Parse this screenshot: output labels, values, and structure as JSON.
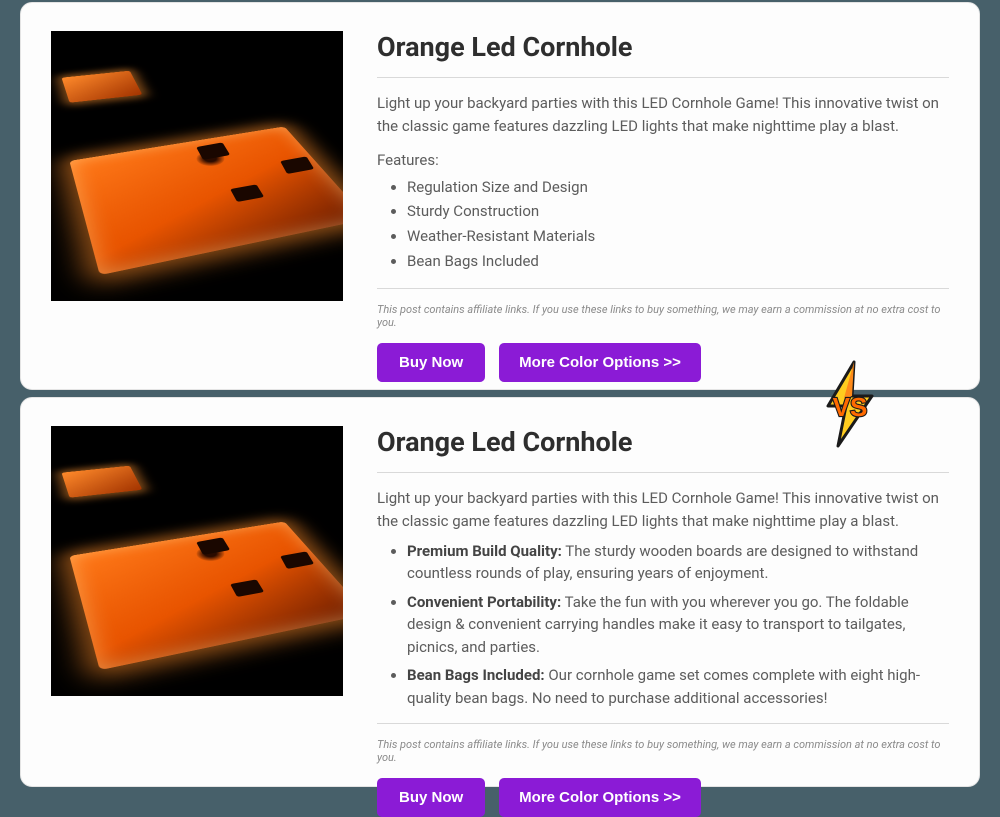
{
  "top": {
    "title": "Orange Led Cornhole",
    "description": "Light up your backyard parties with this LED Cornhole Game! This innovative twist on the classic game features dazzling LED lights that make nighttime play a blast.",
    "features_label": "Features:",
    "features": [
      "Regulation Size and Design",
      "Sturdy Construction",
      "Weather-Resistant Materials",
      "Bean Bags Included"
    ],
    "disclaimer": "This post contains affiliate links. If you use these links to buy something, we may earn a commission at no extra cost to you.",
    "buy_label": "Buy Now",
    "more_label": "More Color Options >>"
  },
  "bottom": {
    "title": "Orange Led Cornhole",
    "description": "Light up your backyard parties with this LED Cornhole Game! This innovative twist on the classic game features dazzling LED lights that make nighttime play a blast.",
    "features": [
      {
        "bold": "Premium Build Quality:",
        "text": " The sturdy wooden boards are designed to withstand countless rounds of play, ensuring years of enjoyment."
      },
      {
        "bold": "Convenient Portability:",
        "text": " Take the fun with you wherever you go. The foldable design & convenient carrying handles make it easy to transport to tailgates, picnics, and parties."
      },
      {
        "bold": "Bean Bags Included:",
        "text": " Our cornhole game set comes complete with eight high-quality bean bags. No need to purchase additional accessories!"
      }
    ],
    "disclaimer": "This post contains affiliate links. If you use these links to buy something, we may earn a commission at no extra cost to you.",
    "buy_label": "Buy Now",
    "more_label": "More Color Options >>"
  },
  "vs_label": "VS"
}
